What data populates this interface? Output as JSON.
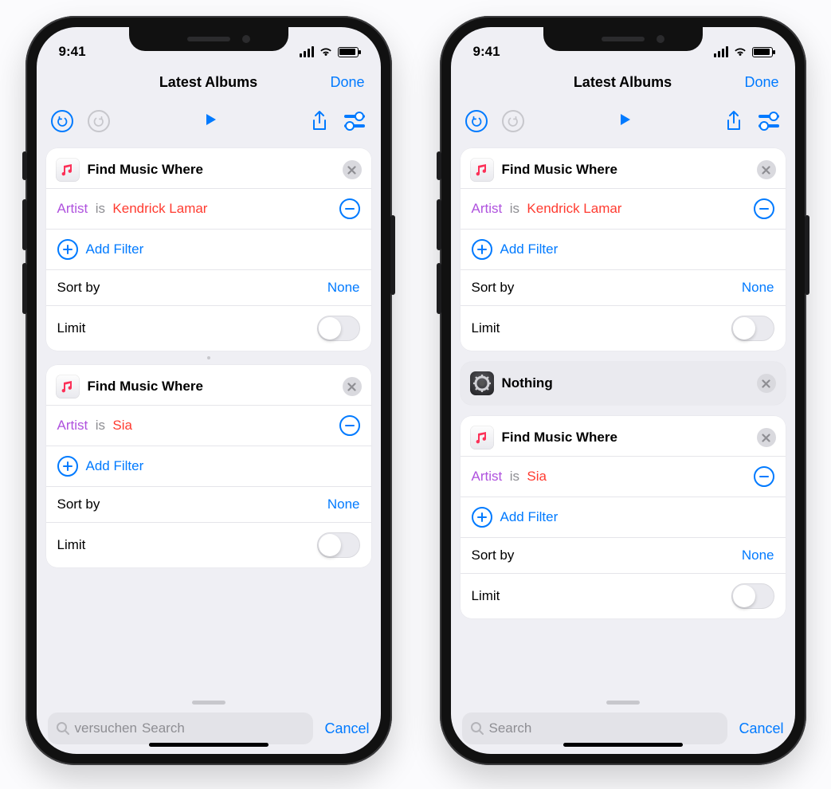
{
  "status": {
    "time": "9:41"
  },
  "nav": {
    "title": "Latest Albums",
    "done": "Done"
  },
  "actions": {
    "find_music_title": "Find Music Where",
    "nothing_title": "Nothing",
    "filter_key": "Artist",
    "filter_op": "is",
    "artist_kendrick": "Kendrick Lamar",
    "artist_sia": "Sia",
    "add_filter": "Add Filter",
    "sort_by": "Sort by",
    "sort_value": "None",
    "limit": "Limit"
  },
  "footer": {
    "search_placeholder": "Search",
    "cancel": "Cancel"
  }
}
